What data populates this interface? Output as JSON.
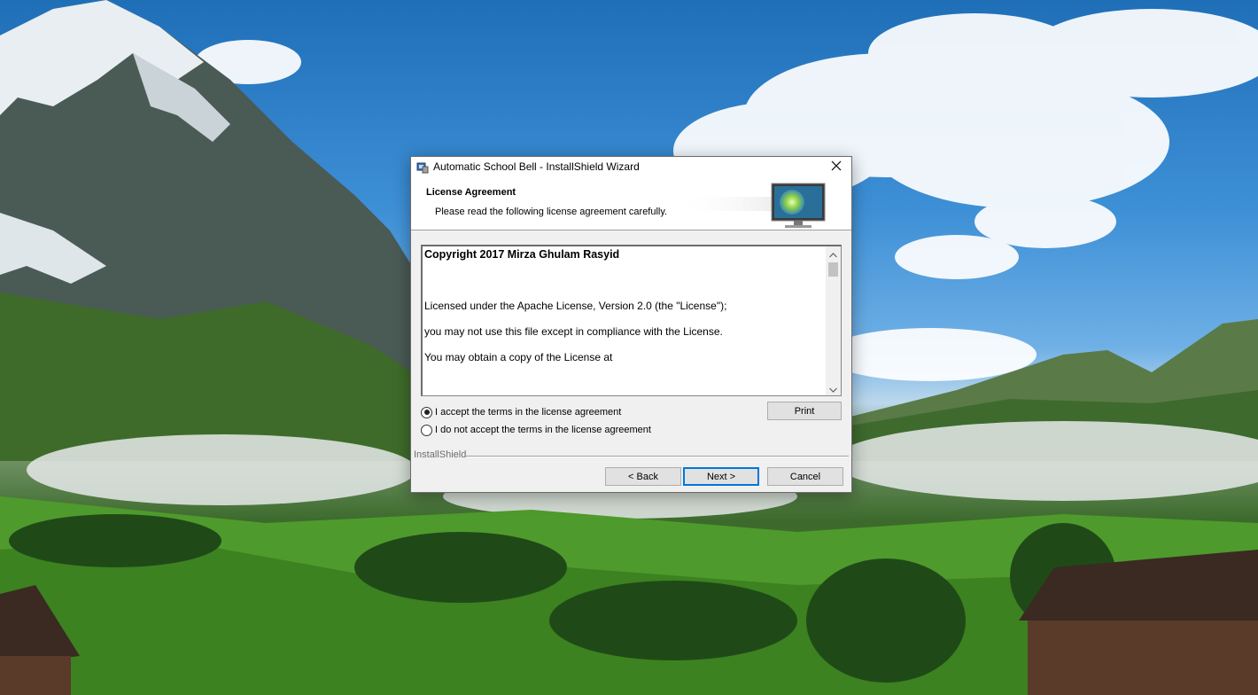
{
  "window": {
    "title": "Automatic School Bell - InstallShield Wizard"
  },
  "banner": {
    "title": "License Agreement",
    "subtitle": "Please read the following license agreement carefully."
  },
  "license": {
    "lines": [
      "Copyright 2017 Mirza Ghulam Rasyid",
      "Licensed under the Apache License, Version 2.0 (the \"License\");",
      "you may not use this file except in compliance with the License.",
      "You may obtain a copy of the License at"
    ]
  },
  "options": {
    "accept_label": "I accept the terms in the license agreement",
    "decline_label": "I do not accept the terms in the license agreement",
    "accept_checked": true
  },
  "buttons": {
    "print": "Print",
    "back": "< Back",
    "next": "Next >",
    "cancel": "Cancel"
  },
  "footer": {
    "brand": "InstallShield"
  },
  "icons": {
    "app": "installer-icon",
    "close": "close-icon",
    "banner": "monitor-icon",
    "scroll_up": "chevron-up-icon",
    "scroll_down": "chevron-down-icon"
  },
  "colors": {
    "default_button_border": "#0078d7"
  }
}
